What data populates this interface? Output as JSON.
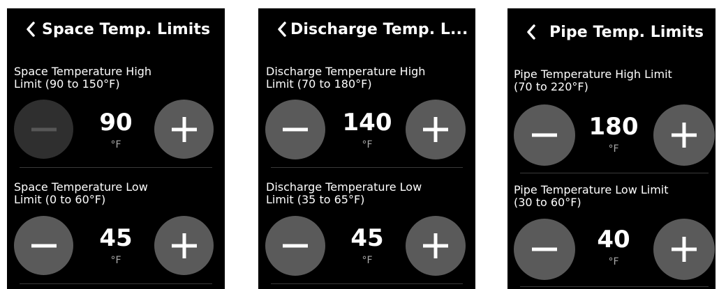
{
  "panels": [
    {
      "title": "Space Temp. Limits",
      "back_icon": "chevron-left-icon",
      "high": {
        "label_line1": "Space Temperature High",
        "label_line2": "Limit (90 to 150°F)",
        "value": "90",
        "unit": "°F",
        "minus_disabled": true
      },
      "low": {
        "label_line1": "Space Temperature Low",
        "label_line2": "Limit (0 to 60°F)",
        "value": "45",
        "unit": "°F",
        "minus_disabled": false
      }
    },
    {
      "title": "Discharge Temp. L...",
      "back_icon": "chevron-left-icon",
      "high": {
        "label_line1": "Discharge Temperature High",
        "label_line2": "Limit (70 to 180°F)",
        "value": "140",
        "unit": "°F",
        "minus_disabled": false
      },
      "low": {
        "label_line1": "Discharge Temperature Low",
        "label_line2": "Limit (35 to 65°F)",
        "value": "45",
        "unit": "°F",
        "minus_disabled": false
      }
    },
    {
      "title": "Pipe Temp. Limits",
      "back_icon": "chevron-left-icon",
      "high": {
        "label_line1": "Pipe Temperature High Limit",
        "label_line2": "(70 to 220°F)",
        "value": "180",
        "unit": "°F",
        "minus_disabled": false
      },
      "low": {
        "label_line1": "Pipe Temperature Low Limit",
        "label_line2": "(30 to 60°F)",
        "value": "40",
        "unit": "°F",
        "minus_disabled": false
      }
    }
  ],
  "colors": {
    "background": "#000000",
    "button": "#5a5a5a",
    "button_disabled": "#2f2f2f",
    "divider": "#3a3a3a",
    "unit_text": "#a8a8a8"
  }
}
